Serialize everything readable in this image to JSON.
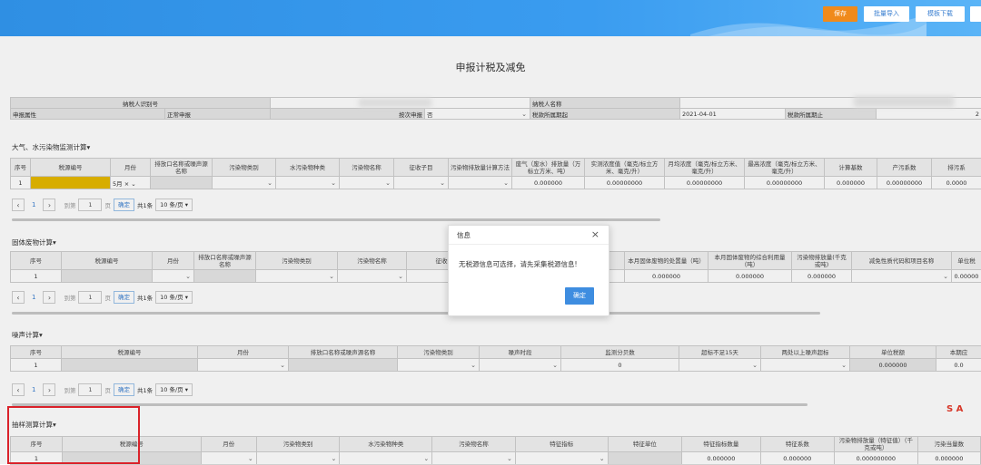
{
  "toolbar": {
    "save": "保存",
    "batch_import": "批量导入",
    "template_download": "模板下载"
  },
  "page_title": "申报计税及减免",
  "taxpayer": {
    "id_label": "纳税人识别号",
    "name_label": "纳税人名称",
    "attr_label": "申报属性",
    "attr_value": "正常申报",
    "per_label": "按次申报",
    "per_value": "否",
    "start_label": "税款所属期起",
    "start_value": "2021-04-01",
    "end_label": "税款所属期止",
    "end_value": "2"
  },
  "air": {
    "title": "大气、水污染物监测计算▾",
    "headers": [
      "序号",
      "税源编号",
      "月份",
      "排放口名称或噪声源名称",
      "污染物类别",
      "水污染物种类",
      "污染物名称",
      "征收子目",
      "污染物排放量计算方法",
      "废气（废水）排放量（万标立方米、吨）",
      "实测浓度值（毫克/标立方米、毫克/升）",
      "月均浓度（毫克/标立方米、毫克/升）",
      "最高浓度（毫克/标立方米、毫克/升）",
      "计算基数",
      "产污系数",
      "排污系"
    ],
    "row": {
      "no": "1",
      "month": "5月",
      "v1": "0.000000",
      "v2": "0.00000000",
      "v3": "0.00000000",
      "v4": "0.00000000",
      "v5": "0.000000",
      "v6": "0.00000000",
      "v7": "0.0000"
    }
  },
  "pager": {
    "page": "1",
    "goto": "到第",
    "input": "1",
    "unit": "页",
    "confirm": "确定",
    "total": "共1条",
    "size": "10 条/页 ▾"
  },
  "solid": {
    "title": "固体废物计算▾",
    "headers": [
      "序号",
      "税源编号",
      "月份",
      "排放口名称或噪声源名称",
      "污染物类别",
      "污染物名称",
      "征收子目",
      "",
      "本月固体废物的处置量（吨）",
      "本月固体废物的综合利用量（吨）",
      "污染物排放量(千克或吨)",
      "减免性质代码和项目名称",
      "单位税"
    ],
    "row": {
      "no": "1",
      "v1": "0.000000",
      "v2": "0.000000",
      "v3": "0.000000",
      "v4": "0.00000"
    }
  },
  "noise": {
    "title": "噪声计算▾",
    "headers": [
      "序号",
      "税源编号",
      "月份",
      "排放口名称或噪声源名称",
      "污染物类别",
      "噪声时段",
      "监测分贝数",
      "超标不足15天",
      "两处以上噪声超标",
      "单位税额",
      "本期应"
    ],
    "row": {
      "no": "1",
      "db": "0",
      "v1": "0.000000",
      "v2": "0.0"
    }
  },
  "sample": {
    "title": "抽样测算计算▾",
    "headers": [
      "序号",
      "税源编号",
      "月份",
      "污染物类别",
      "水污染物种类",
      "污染物名称",
      "特征指标",
      "特征单位",
      "特征指标数量",
      "特征系数",
      "污染物排放量（特征值）（千克或吨）",
      "污染当量数"
    ],
    "row": {
      "no": "1",
      "v1": "0.000000",
      "v2": "0.000000",
      "v3": "0.000000000",
      "v4": "0.000000"
    }
  },
  "dialog": {
    "title": "信息",
    "close": "×",
    "message": "无税源信息可选择，请先采集税源信息!",
    "ok": "确定"
  },
  "logo": "S A",
  "colors": {
    "topbar": "#3a9cf0",
    "save": "#f08a1b",
    "primary": "#3e8de0",
    "highlight": "#e5b800",
    "red_box": "#e8252d"
  }
}
